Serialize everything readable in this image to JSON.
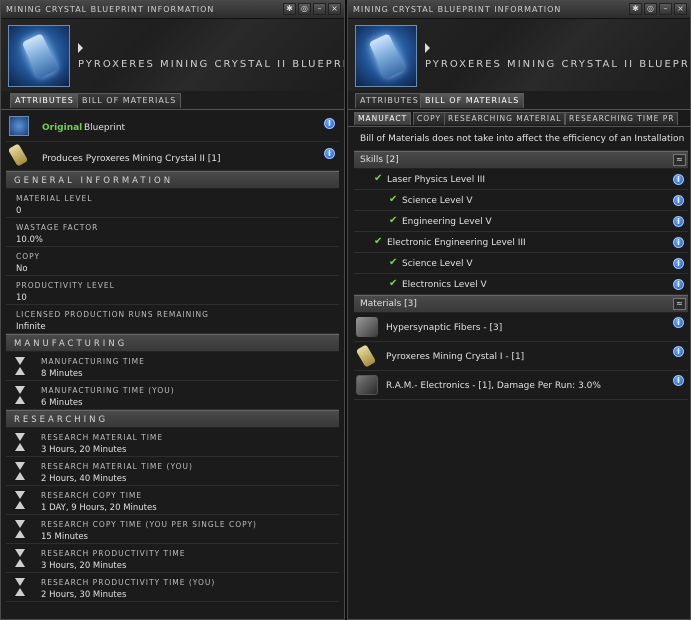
{
  "left": {
    "title": "MINING CRYSTAL BLUEPRINT INFORMATION",
    "item_name": "PYROXERES MINING CRYSTAL II BLUEPRINT",
    "tabs": [
      "ATTRIBUTES",
      "BILL OF MATERIALS"
    ],
    "original_label": "Original",
    "blueprint_word": "Blueprint",
    "produces": "Produces Pyroxeres Mining Crystal II [1]",
    "sections": {
      "general": "GENERAL INFORMATION",
      "manufacturing": "MANUFACTURING",
      "researching": "RESEARCHING"
    },
    "general": [
      {
        "label": "MATERIAL LEVEL",
        "value": "0"
      },
      {
        "label": "WASTAGE FACTOR",
        "value": "10.0%"
      },
      {
        "label": "COPY",
        "value": "No"
      },
      {
        "label": "PRODUCTIVITY LEVEL",
        "value": "10"
      },
      {
        "label": "LICENSED PRODUCTION RUNS REMAINING",
        "value": "Infinite"
      }
    ],
    "manufacturing": [
      {
        "label": "MANUFACTURING TIME",
        "value": "8 Minutes"
      },
      {
        "label": "MANUFACTURING TIME (YOU)",
        "value": "6 Minutes"
      }
    ],
    "researching": [
      {
        "label": "RESEARCH MATERIAL TIME",
        "value": "3 Hours, 20 Minutes"
      },
      {
        "label": "RESEARCH MATERIAL TIME (YOU)",
        "value": "2 Hours, 40 Minutes"
      },
      {
        "label": "RESEARCH COPY TIME",
        "value": "1 DAY, 9 Hours, 20 Minutes"
      },
      {
        "label": "RESEARCH COPY TIME (YOU PER SINGLE COPY)",
        "value": "15 Minutes"
      },
      {
        "label": "RESEARCH PRODUCTIVITY TIME",
        "value": "3 Hours, 20 Minutes"
      },
      {
        "label": "RESEARCH PRODUCTIVITY TIME (YOU)",
        "value": "2 Hours, 30 Minutes"
      }
    ]
  },
  "right": {
    "title": "MINING CRYSTAL BLUEPRINT INFORMATION",
    "item_name": "PYROXERES MINING CRYSTAL II BLUEPRINT",
    "tabs": [
      "ATTRIBUTES",
      "BILL OF MATERIALS"
    ],
    "subtabs": [
      "MANUFACT",
      "COPY",
      "RESEARCHING MATERIAL",
      "RESEARCHING TIME PR"
    ],
    "notice": "Bill of Materials does not take into affect the efficiency of an Installation",
    "skills_header": "Skills [2]",
    "skills": [
      {
        "name": "Laser Physics Level III",
        "indent": 0
      },
      {
        "name": "Science Level V",
        "indent": 1
      },
      {
        "name": "Engineering Level V",
        "indent": 1
      },
      {
        "name": "Electronic Engineering Level III",
        "indent": 0
      },
      {
        "name": "Science Level V",
        "indent": 1
      },
      {
        "name": "Electronics Level V",
        "indent": 1
      }
    ],
    "materials_header": "Materials [3]",
    "materials": [
      {
        "name": "Hypersynaptic Fibers - [3]",
        "icon": "fibers-icon"
      },
      {
        "name": "Pyroxeres Mining Crystal I - [1]",
        "icon": "crystal-icon"
      },
      {
        "name": "R.A.M.- Electronics - [1], Damage Per Run: 3.0%",
        "icon": "ram-icon"
      }
    ]
  },
  "window_buttons": [
    "✱",
    "◎",
    "–",
    "×"
  ],
  "info_glyph": "i",
  "collapse_glyph": "≈",
  "check_glyph": "✔",
  "colors": {
    "original": "#6fd14a",
    "info": "#1f5ac8",
    "check": "#7fd34a"
  }
}
